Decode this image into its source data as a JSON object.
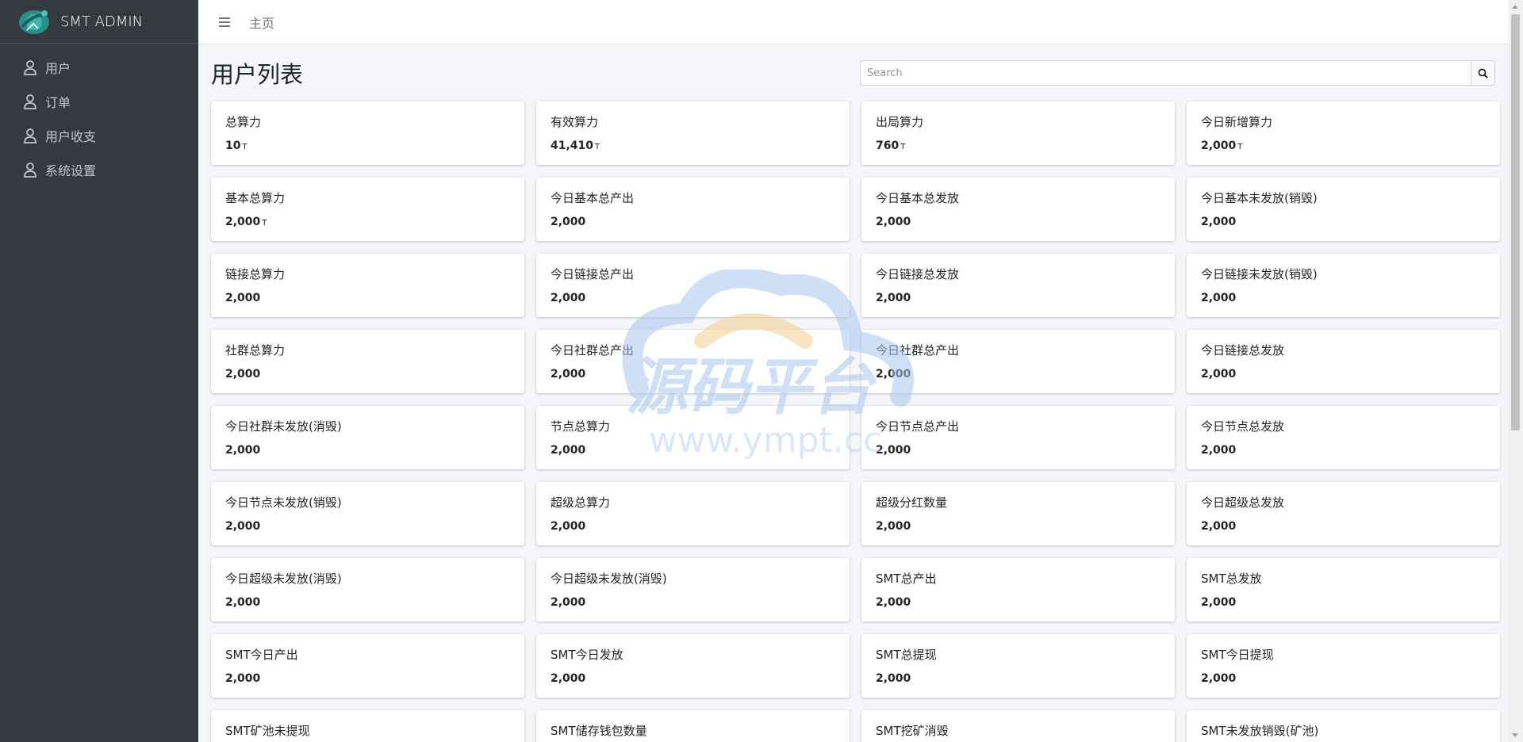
{
  "brand": {
    "name": "SMT ADMIN",
    "logo_icon": "smt-logo-icon"
  },
  "sidebar": {
    "items": [
      {
        "label": "用户",
        "icon": "user-icon"
      },
      {
        "label": "订单",
        "icon": "user-icon"
      },
      {
        "label": "用户收支",
        "icon": "user-icon"
      },
      {
        "label": "系统设置",
        "icon": "user-icon"
      }
    ]
  },
  "topbar": {
    "menu_icon": "hamburger-icon",
    "home_label": "主页"
  },
  "page": {
    "title": "用户列表"
  },
  "search": {
    "placeholder": "Search",
    "icon": "search-icon"
  },
  "stats": [
    {
      "label": "总算力",
      "value": "10",
      "unit": "T"
    },
    {
      "label": "有效算力",
      "value": "41,410",
      "unit": "T"
    },
    {
      "label": "出局算力",
      "value": "760",
      "unit": "T"
    },
    {
      "label": "今日新增算力",
      "value": "2,000",
      "unit": "T"
    },
    {
      "label": "基本总算力",
      "value": "2,000",
      "unit": "T"
    },
    {
      "label": "今日基本总产出",
      "value": "2,000",
      "unit": ""
    },
    {
      "label": "今日基本总发放",
      "value": "2,000",
      "unit": ""
    },
    {
      "label": "今日基本未发放(销毁)",
      "value": "2,000",
      "unit": ""
    },
    {
      "label": "链接总算力",
      "value": "2,000",
      "unit": ""
    },
    {
      "label": "今日链接总产出",
      "value": "2,000",
      "unit": ""
    },
    {
      "label": "今日链接总发放",
      "value": "2,000",
      "unit": ""
    },
    {
      "label": "今日链接未发放(销毁)",
      "value": "2,000",
      "unit": ""
    },
    {
      "label": "社群总算力",
      "value": "2,000",
      "unit": ""
    },
    {
      "label": "今日社群总产出",
      "value": "2,000",
      "unit": ""
    },
    {
      "label": "今日社群总产出",
      "value": "2,000",
      "unit": ""
    },
    {
      "label": "今日链接总发放",
      "value": "2,000",
      "unit": ""
    },
    {
      "label": "今日社群未发放(消毁)",
      "value": "2,000",
      "unit": ""
    },
    {
      "label": "节点总算力",
      "value": "2,000",
      "unit": ""
    },
    {
      "label": "今日节点总产出",
      "value": "2,000",
      "unit": ""
    },
    {
      "label": "今日节点总发放",
      "value": "2,000",
      "unit": ""
    },
    {
      "label": "今日节点未发放(销毁)",
      "value": "2,000",
      "unit": ""
    },
    {
      "label": "超级总算力",
      "value": "2,000",
      "unit": ""
    },
    {
      "label": "超级分红数量",
      "value": "2,000",
      "unit": ""
    },
    {
      "label": "今日超级总发放",
      "value": "2,000",
      "unit": ""
    },
    {
      "label": "今日超级未发放(消毁)",
      "value": "2,000",
      "unit": ""
    },
    {
      "label": "今日超级未发放(消毁)",
      "value": "2,000",
      "unit": ""
    },
    {
      "label": "SMT总产出",
      "value": "2,000",
      "unit": ""
    },
    {
      "label": "SMT总发放",
      "value": "2,000",
      "unit": ""
    },
    {
      "label": "SMT今日产出",
      "value": "2,000",
      "unit": ""
    },
    {
      "label": "SMT今日发放",
      "value": "2,000",
      "unit": ""
    },
    {
      "label": "SMT总提现",
      "value": "2,000",
      "unit": ""
    },
    {
      "label": "SMT今日提现",
      "value": "2,000",
      "unit": ""
    },
    {
      "label": "SMT矿池未提现",
      "value": "",
      "unit": ""
    },
    {
      "label": "SMT储存钱包数量",
      "value": "",
      "unit": ""
    },
    {
      "label": "SMT挖矿消毁",
      "value": "",
      "unit": ""
    },
    {
      "label": "SMT未发放销毁(矿池)",
      "value": "",
      "unit": ""
    }
  ],
  "watermark": {
    "title": "源码平台",
    "url": "www.ympt.cc"
  },
  "colors": {
    "sidebar_bg": "#343a40",
    "sidebar_text": "#c2c7d0",
    "page_bg": "#f4f6f9",
    "card_bg": "#ffffff"
  }
}
